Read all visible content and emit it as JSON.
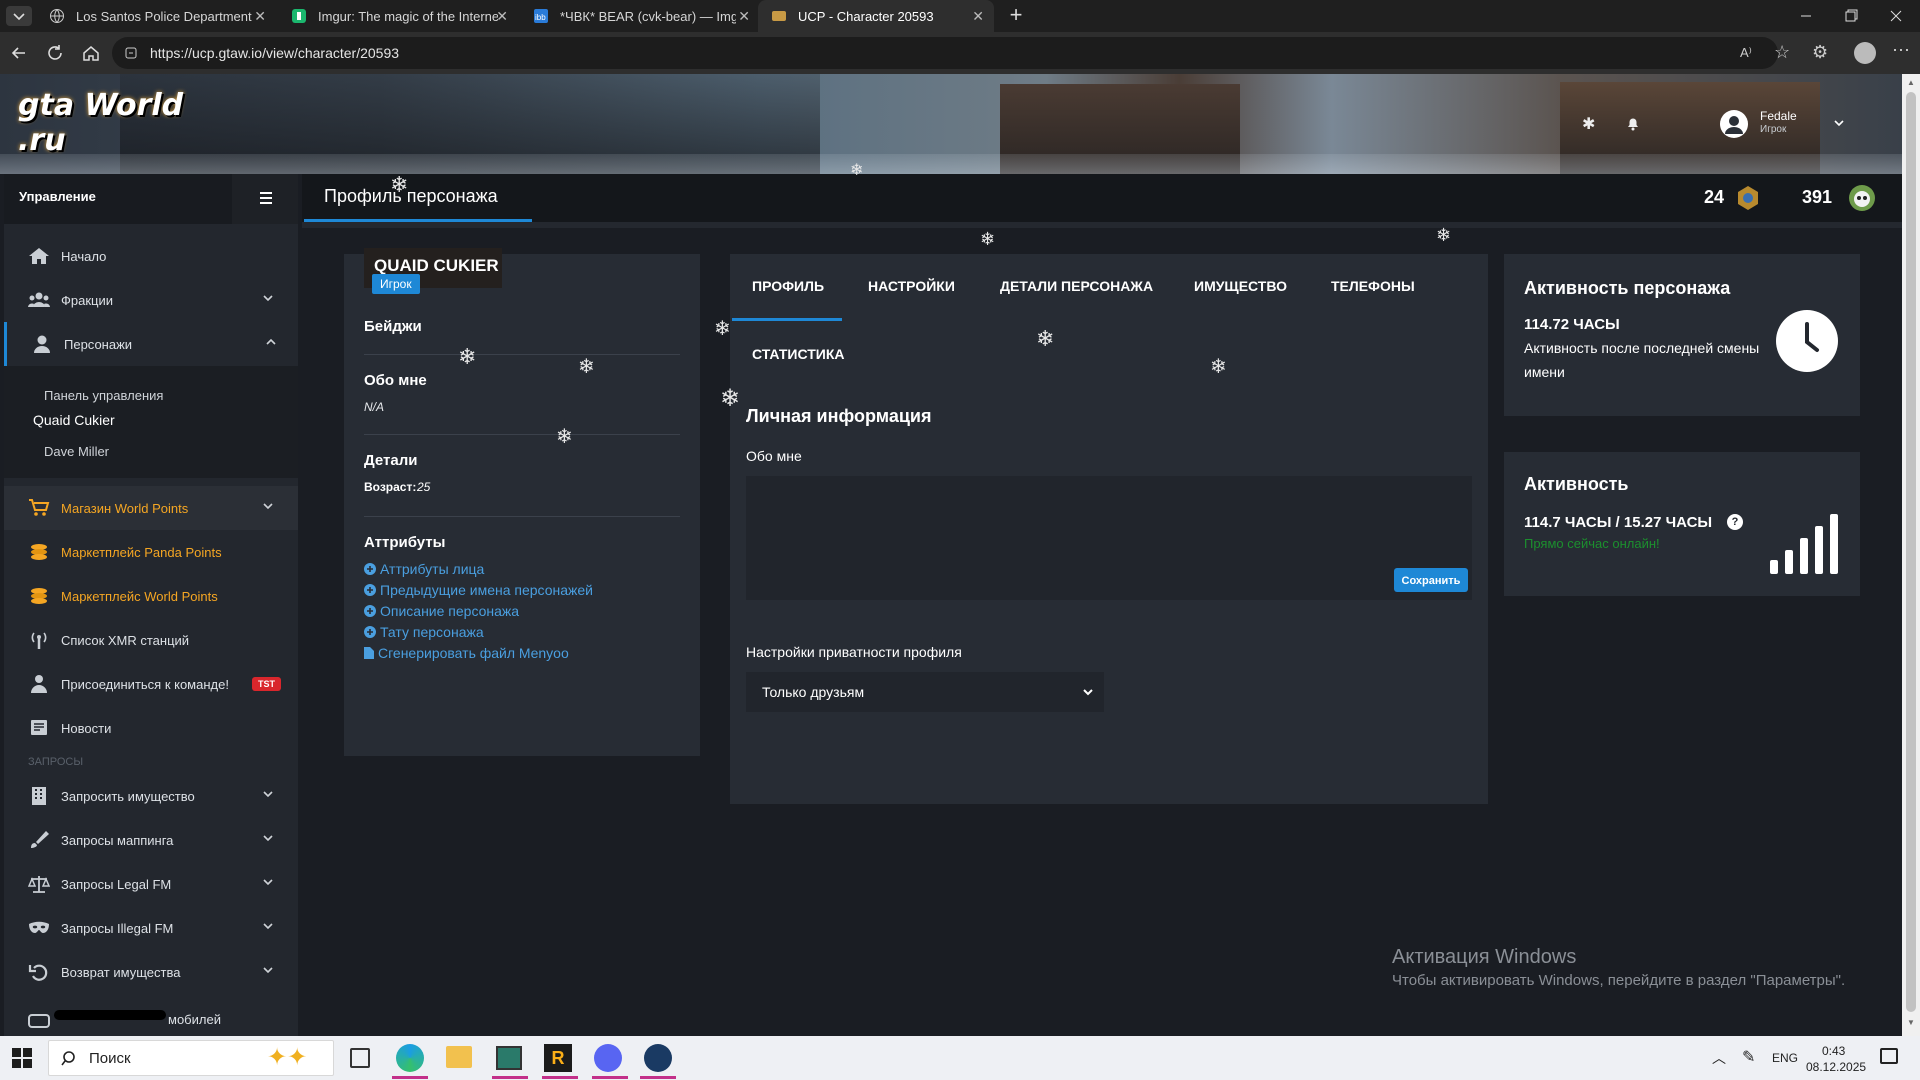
{
  "browser": {
    "tabs": [
      {
        "title": "Los Santos Police Department - H",
        "icon": "globe-icon"
      },
      {
        "title": "Imgur: The magic of the Internet",
        "icon": "imgur-icon"
      },
      {
        "title": "*ЧВК* BEAR (cvk-bear) — ImgBB",
        "icon": "imgbb-icon"
      },
      {
        "title": "UCP - Character 20593",
        "icon": "gtaw-icon"
      }
    ],
    "url": "https://ucp.gtaw.io/view/character/20593"
  },
  "header": {
    "logo_text": "gta World .ru",
    "user_name": "Fedale",
    "user_role": "Игрок"
  },
  "sidebar": {
    "title": "Управление",
    "items": [
      {
        "label": "Начало",
        "icon": "home-icon",
        "chevron": false
      },
      {
        "label": "Фракции",
        "icon": "users-icon",
        "chevron": true
      },
      {
        "label": "Персонажи",
        "icon": "user-icon",
        "chevron": true
      }
    ],
    "subitems": [
      "Панель управления",
      "Quaid Cukier",
      "Dave Miller"
    ],
    "shop_items": [
      {
        "label": "Магазин World Points",
        "icon": "cart-icon"
      },
      {
        "label": "Маркетплейс Panda Points",
        "icon": "coins-icon"
      },
      {
        "label": "Маркетплейс World Points",
        "icon": "coins-icon"
      }
    ],
    "other_items": [
      {
        "label": "Список XMR станций",
        "icon": "antenna-icon"
      },
      {
        "label": "Присоединиться к команде!",
        "icon": "user-tie-icon",
        "badge": "TST"
      },
      {
        "label": "Новости",
        "icon": "newspaper-icon"
      }
    ],
    "section_label": "ЗАПРОСЫ",
    "request_items": [
      {
        "label": "Запросить имущество",
        "icon": "building-icon"
      },
      {
        "label": "Запросы маппинга",
        "icon": "brush-icon"
      },
      {
        "label": "Запросы Legal FM",
        "icon": "scales-icon"
      },
      {
        "label": "Запросы Illegal FM",
        "icon": "mask-icon"
      },
      {
        "label": "Возврат имущества",
        "icon": "undo-icon"
      }
    ],
    "cut_item": "мобилей"
  },
  "page": {
    "title": "Профиль персонажа",
    "counter1": "24",
    "counter2": "391"
  },
  "character": {
    "name": "QUAID CUKIER",
    "role": "Игрок",
    "badges_label": "Бейджи",
    "about_label": "Обо мне",
    "about_value": "N/A",
    "details_label": "Детали",
    "age_label": "Возраст:",
    "age_value": "25",
    "attributes_label": "Аттрибуты",
    "attribute_links": [
      "Аттрибуты лица",
      "Предыдущие имена персонажей",
      "Описание персонажа",
      "Тату персонажа"
    ],
    "file_link": "Сгенерировать файл Menyoo"
  },
  "tabs": [
    "ПРОФИЛЬ",
    "НАСТРОЙКИ",
    "ДЕТАЛИ ПЕРСОНАЖА",
    "ИМУЩЕСТВО",
    "ТЕЛЕФОНЫ",
    "СТАТИСТИКА"
  ],
  "profile": {
    "section_title": "Личная информация",
    "about_label": "Обо мне",
    "about_value": "",
    "save_label": "Сохранить",
    "privacy_label": "Настройки приватности профиля",
    "privacy_value": "Только друзьям"
  },
  "activity_char": {
    "title": "Активность персонажа",
    "hours": "114.72 ЧАСЫ",
    "desc": "Активность после последней смены имени"
  },
  "activity": {
    "title": "Активность",
    "hours": "114.7 ЧАСЫ / 15.27 ЧАСЫ",
    "status": "Прямо сейчас онлайн!"
  },
  "watermark": {
    "title": "Активация Windows",
    "text": "Чтобы активировать Windows, перейдите в раздел \"Параметры\"."
  },
  "taskbar": {
    "search_placeholder": "Поиск",
    "lang": "ENG",
    "time": "0:43",
    "date": "08.12.2025"
  },
  "colors": {
    "accent": "#1e88d6",
    "shop": "#f5a623",
    "online": "#1c8f2e",
    "badge_red": "#d9262c"
  }
}
